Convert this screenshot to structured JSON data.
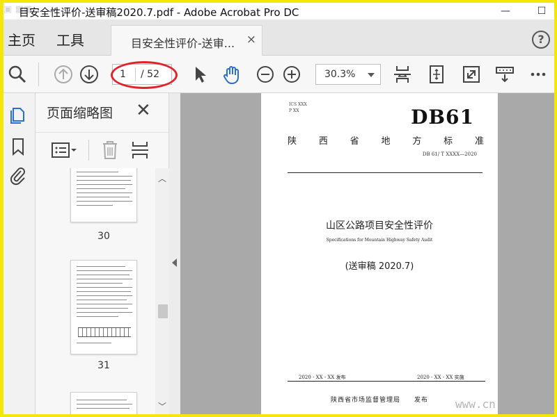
{
  "window": {
    "title": "目安全性评价-送审稿2020.7.pdf - Adobe Acrobat Pro DC",
    "minimize": "—",
    "maximize": "☐"
  },
  "menu": {
    "home": "主页",
    "tools": "工具"
  },
  "tab": {
    "label": "目安全性评价-送审...",
    "close": "×"
  },
  "help": "?",
  "toolbar": {
    "page_current": "1",
    "page_total": "/ 52",
    "zoom": "30.3%"
  },
  "thumbnails": {
    "title": "页面缩略图",
    "close": "✕",
    "pages": [
      {
        "label": "30"
      },
      {
        "label": "31"
      }
    ]
  },
  "document": {
    "ics": "ICS XXX",
    "p": "P XX",
    "db_code": "DB61",
    "province_chars": [
      "陕",
      "西",
      "省",
      "地",
      "方",
      "标",
      "准"
    ],
    "standard_number": "DB 61/ T XXXX—2020",
    "title_cn": "山区公路项目安全性评价",
    "title_en": "Specifications for Mountain Highway Safety Audit",
    "draft": "(送审稿 2020.7)",
    "issue_date": "2020 - XX - XX 发布",
    "impl_date": "2020 - XX - XX 实施",
    "issuer": "陕西省市场监督管理局　　发布"
  },
  "watermark": "www.cn",
  "colors": {
    "frame": "#f5e60a",
    "annotation_red": "#e0232a",
    "hand_tool_blue": "#2a6ed1"
  }
}
